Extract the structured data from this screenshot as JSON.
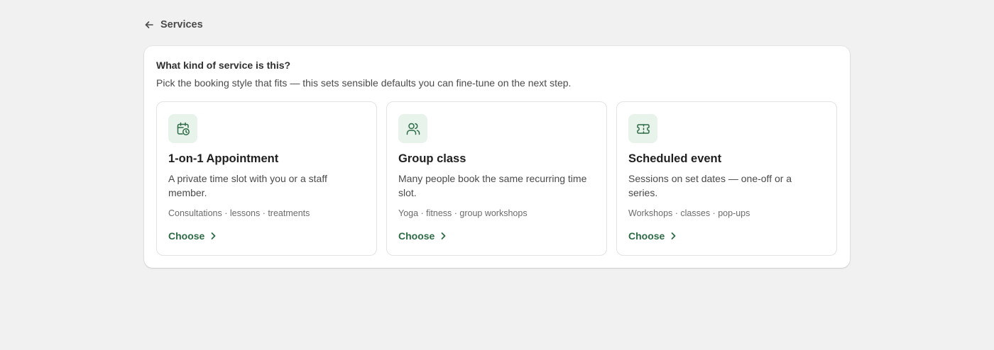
{
  "breadcrumb": {
    "icon": "arrow-left-icon",
    "label": "Services"
  },
  "card": {
    "title": "What kind of service is this?",
    "subtitle": "Pick the booking style that fits — this sets sensible defaults you can fine-tune on the next step."
  },
  "options": [
    {
      "icon": "calendar-clock-icon",
      "title": "1-on-1 Appointment",
      "description": "A private time slot with you or a staff member.",
      "tags": "Consultations · lessons · treatments",
      "choose_label": "Choose"
    },
    {
      "icon": "users-icon",
      "title": "Group class",
      "description": "Many people book the same recurring time slot.",
      "tags": "Yoga · fitness · group workshops",
      "choose_label": "Choose"
    },
    {
      "icon": "ticket-icon",
      "title": "Scheduled event",
      "description": "Sessions on set dates — one-off or a series.",
      "tags": "Workshops · classes · pop-ups",
      "choose_label": "Choose"
    }
  ],
  "colors": {
    "background": "#f1f1f1",
    "accent": "#2c6b45",
    "icon_tile": "#e8f3ec"
  }
}
